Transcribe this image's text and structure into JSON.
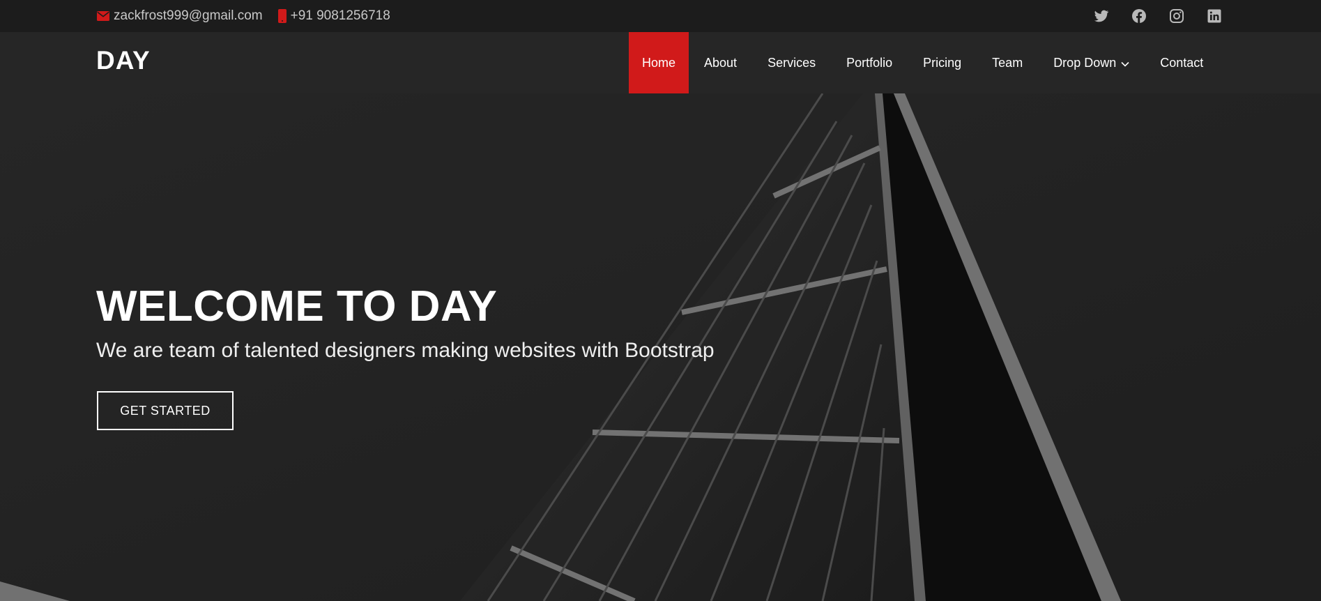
{
  "topbar": {
    "email": "zackfrost999@gmail.com",
    "phone": "+91 9081256718",
    "social_icons": [
      "twitter-icon",
      "facebook-icon",
      "instagram-icon",
      "linkedin-icon"
    ]
  },
  "header": {
    "logo": "DAY",
    "nav": [
      {
        "label": "Home",
        "active": true
      },
      {
        "label": "About"
      },
      {
        "label": "Services"
      },
      {
        "label": "Portfolio"
      },
      {
        "label": "Pricing"
      },
      {
        "label": "Team"
      },
      {
        "label": "Drop Down",
        "has_dropdown": true
      },
      {
        "label": "Contact"
      }
    ]
  },
  "hero": {
    "title": "WELCOME TO DAY",
    "subtitle": "We are team of talented designers making websites with Bootstrap",
    "cta_label": "GET STARTED"
  },
  "colors": {
    "accent": "#d11a1a",
    "topbar_bg": "#1c1c1c",
    "header_bg": "#262626",
    "hero_bg": "#2a2a2a"
  }
}
